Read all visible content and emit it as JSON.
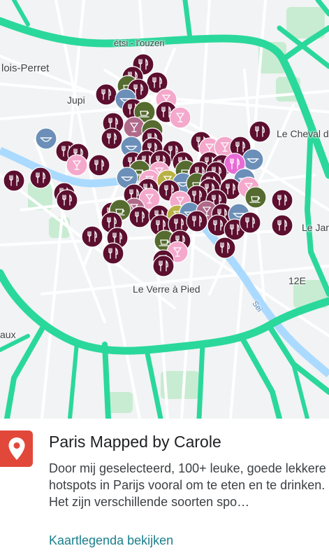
{
  "map": {
    "labels": {
      "top_street": "étsi - l'ouzeri",
      "levallois": "lois-Perret",
      "jupi": "Jupi",
      "cheval": "Le Cheval d",
      "jar": "Le Jar",
      "verre": "Le Verre à Pied",
      "arrondissement": "12E",
      "seine": "Sei",
      "aux": "aux"
    },
    "colors": {
      "road_major": "#2ad89b",
      "road_minor": "#ffffff",
      "water": "#aadaff",
      "park": "#c8ecd2",
      "land": "#f1f3f4",
      "marker_bordeaux": "#5c0f2e",
      "marker_olive": "#556b2f",
      "marker_pink": "#f4a8cc",
      "marker_mauve": "#b06a8a",
      "marker_blue": "#6b8fb8",
      "marker_yellow": "#b8b246",
      "marker_magenta": "#e86bd6"
    },
    "markers": [
      {
        "type": "restaurant",
        "color": "bordeaux",
        "icon": "fork-knife-icon"
      },
      {
        "type": "drinks",
        "color": "pink",
        "icon": "cocktail-icon"
      },
      {
        "type": "coffee",
        "color": "olive",
        "icon": "coffee-icon"
      },
      {
        "type": "bakery",
        "color": "blue",
        "icon": "bowl-icon"
      },
      {
        "type": "wine",
        "color": "mauve",
        "icon": "wine-glass-icon"
      },
      {
        "type": "highlight",
        "color": "magenta",
        "icon": "fork-knife-icon"
      }
    ]
  },
  "sheet": {
    "icon": "map-pin-icon",
    "title": "Paris Mapped by Carole",
    "description": "Door mij geselecteerd, 100+ leuke, goede lekkere hotspots in Parijs vooral om te eten en te drinken. Het zijn verschillende soorten spo…",
    "legend_link": "Kaartlegenda bekijken"
  }
}
